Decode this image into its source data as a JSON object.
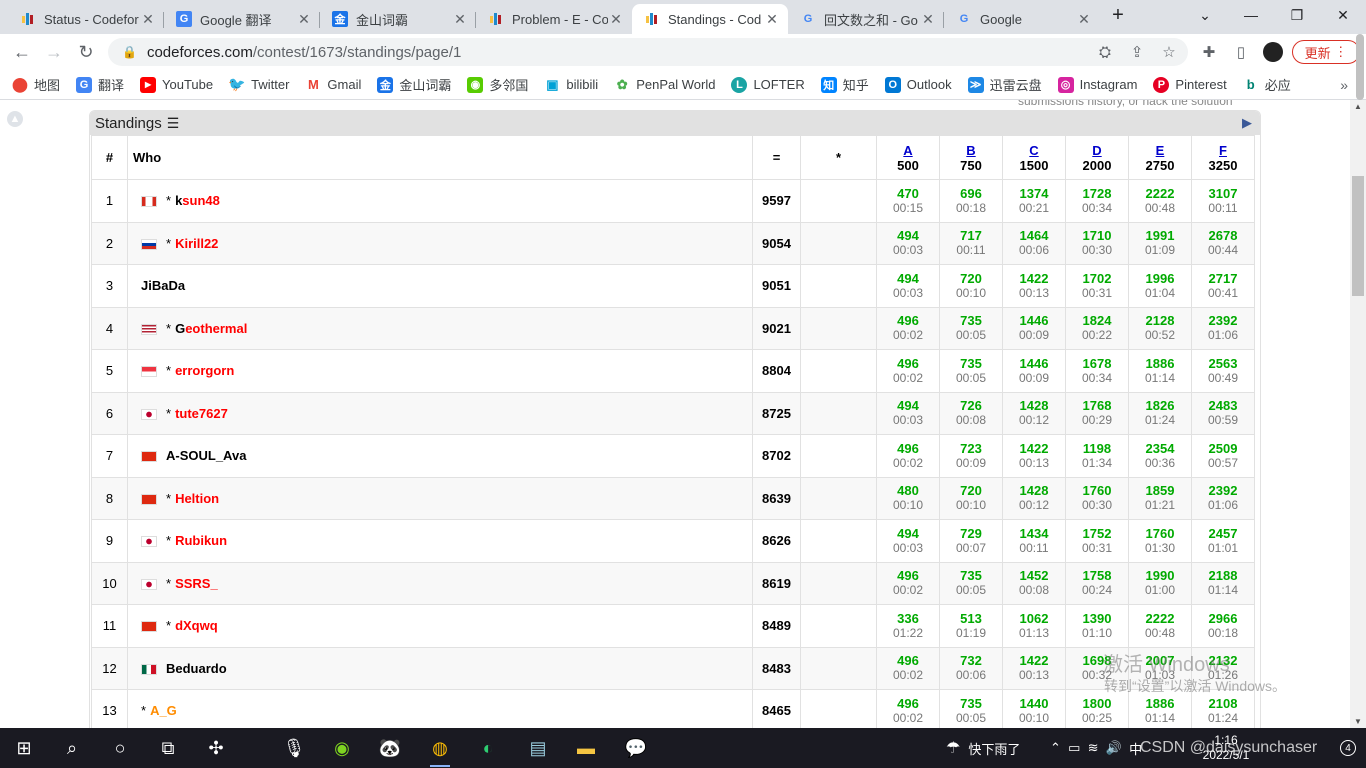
{
  "tabs": [
    {
      "title": "Status - Codefor",
      "icon": "codeforces-icon",
      "active": false
    },
    {
      "title": "Google 翻译",
      "icon": "google-translate-icon",
      "active": false
    },
    {
      "title": "金山词霸",
      "icon": "iciba-icon",
      "active": false
    },
    {
      "title": "Problem - E - Co",
      "icon": "codeforces-icon",
      "active": false
    },
    {
      "title": "Standings - Cod",
      "icon": "codeforces-icon",
      "active": true
    },
    {
      "title": "回文数之和 - Go",
      "icon": "google-icon",
      "active": false
    },
    {
      "title": "Google",
      "icon": "google-icon",
      "active": false
    }
  ],
  "address": {
    "host": "codeforces.com",
    "path": "/contest/1673/standings/page/1"
  },
  "update_label": "更新",
  "bookmarks": [
    "地图",
    "翻译",
    "YouTube",
    "Twitter",
    "Gmail",
    "金山词霸",
    "多邻国",
    "bilibili",
    "PenPal World",
    "LOFTER",
    "知乎",
    "Outlook",
    "迅雷云盘",
    "Instagram",
    "Pinterest",
    "必应"
  ],
  "hint": "submissions history, or hack the solution",
  "standings": {
    "title": "Standings",
    "headers": {
      "rank": "#",
      "who": "Who",
      "penalty": "=",
      "hacks": "*"
    },
    "problems": [
      {
        "letter": "A",
        "points": "500"
      },
      {
        "letter": "B",
        "points": "750"
      },
      {
        "letter": "C",
        "points": "1500"
      },
      {
        "letter": "D",
        "points": "2000"
      },
      {
        "letter": "E",
        "points": "2750"
      },
      {
        "letter": "F",
        "points": "3250"
      }
    ],
    "rows": [
      {
        "rank": "1",
        "flag": "ca",
        "star": "*",
        "first": "k",
        "rest": "sun48",
        "color": "#ff0000",
        "score": "9597",
        "cells": [
          [
            "470",
            "00:15"
          ],
          [
            "696",
            "00:18"
          ],
          [
            "1374",
            "00:21"
          ],
          [
            "1728",
            "00:34"
          ],
          [
            "2222",
            "00:48"
          ],
          [
            "3107",
            "00:11"
          ]
        ]
      },
      {
        "rank": "2",
        "flag": "ru",
        "star": "*",
        "first": "",
        "rest": "Kirill22",
        "color": "#ff0000",
        "score": "9054",
        "cells": [
          [
            "494",
            "00:03"
          ],
          [
            "717",
            "00:11"
          ],
          [
            "1464",
            "00:06"
          ],
          [
            "1710",
            "00:30"
          ],
          [
            "1991",
            "01:09"
          ],
          [
            "2678",
            "00:44"
          ]
        ]
      },
      {
        "rank": "3",
        "flag": "",
        "star": "",
        "first": "",
        "rest": "JiBaDa",
        "color": "#000000",
        "score": "9051",
        "cells": [
          [
            "494",
            "00:03"
          ],
          [
            "720",
            "00:10"
          ],
          [
            "1422",
            "00:13"
          ],
          [
            "1702",
            "00:31"
          ],
          [
            "1996",
            "01:04"
          ],
          [
            "2717",
            "00:41"
          ]
        ]
      },
      {
        "rank": "4",
        "flag": "us",
        "star": "*",
        "first": "G",
        "rest": "eothermal",
        "color": "#ff0000",
        "score": "9021",
        "cells": [
          [
            "496",
            "00:02"
          ],
          [
            "735",
            "00:05"
          ],
          [
            "1446",
            "00:09"
          ],
          [
            "1824",
            "00:22"
          ],
          [
            "2128",
            "00:52"
          ],
          [
            "2392",
            "01:06"
          ]
        ]
      },
      {
        "rank": "5",
        "flag": "sg",
        "star": "*",
        "first": "",
        "rest": "errorgorn",
        "color": "#ff0000",
        "score": "8804",
        "cells": [
          [
            "496",
            "00:02"
          ],
          [
            "735",
            "00:05"
          ],
          [
            "1446",
            "00:09"
          ],
          [
            "1678",
            "00:34"
          ],
          [
            "1886",
            "01:14"
          ],
          [
            "2563",
            "00:49"
          ]
        ]
      },
      {
        "rank": "6",
        "flag": "jp",
        "star": "*",
        "first": "",
        "rest": "tute7627",
        "color": "#ff0000",
        "score": "8725",
        "cells": [
          [
            "494",
            "00:03"
          ],
          [
            "726",
            "00:08"
          ],
          [
            "1428",
            "00:12"
          ],
          [
            "1768",
            "00:29"
          ],
          [
            "1826",
            "01:24"
          ],
          [
            "2483",
            "00:59"
          ]
        ]
      },
      {
        "rank": "7",
        "flag": "cn",
        "star": "",
        "first": "",
        "rest": "A-SOUL_Ava",
        "color": "#000000",
        "score": "8702",
        "cells": [
          [
            "496",
            "00:02"
          ],
          [
            "723",
            "00:09"
          ],
          [
            "1422",
            "00:13"
          ],
          [
            "1198",
            "01:34"
          ],
          [
            "2354",
            "00:36"
          ],
          [
            "2509",
            "00:57"
          ]
        ]
      },
      {
        "rank": "8",
        "flag": "cn",
        "star": "*",
        "first": "",
        "rest": "Heltion",
        "color": "#ff0000",
        "score": "8639",
        "cells": [
          [
            "480",
            "00:10"
          ],
          [
            "720",
            "00:10"
          ],
          [
            "1428",
            "00:12"
          ],
          [
            "1760",
            "00:30"
          ],
          [
            "1859",
            "01:21"
          ],
          [
            "2392",
            "01:06"
          ]
        ]
      },
      {
        "rank": "9",
        "flag": "jp",
        "star": "*",
        "first": "",
        "rest": "Rubikun",
        "color": "#ff0000",
        "score": "8626",
        "cells": [
          [
            "494",
            "00:03"
          ],
          [
            "729",
            "00:07"
          ],
          [
            "1434",
            "00:11"
          ],
          [
            "1752",
            "00:31"
          ],
          [
            "1760",
            "01:30"
          ],
          [
            "2457",
            "01:01"
          ]
        ]
      },
      {
        "rank": "10",
        "flag": "jp",
        "star": "*",
        "first": "",
        "rest": "SSRS_",
        "color": "#ff0000",
        "score": "8619",
        "cells": [
          [
            "496",
            "00:02"
          ],
          [
            "735",
            "00:05"
          ],
          [
            "1452",
            "00:08"
          ],
          [
            "1758",
            "00:24"
          ],
          [
            "1990",
            "01:00"
          ],
          [
            "2188",
            "01:14"
          ]
        ]
      },
      {
        "rank": "11",
        "flag": "cn",
        "star": "*",
        "first": "",
        "rest": "dXqwq",
        "color": "#ff0000",
        "score": "8489",
        "cells": [
          [
            "336",
            "01:22"
          ],
          [
            "513",
            "01:19"
          ],
          [
            "1062",
            "01:13"
          ],
          [
            "1390",
            "01:10"
          ],
          [
            "2222",
            "00:48"
          ],
          [
            "2966",
            "00:18"
          ]
        ]
      },
      {
        "rank": "12",
        "flag": "mx",
        "star": "",
        "first": "",
        "rest": "Beduardo",
        "color": "#000000",
        "score": "8483",
        "cells": [
          [
            "496",
            "00:02"
          ],
          [
            "732",
            "00:06"
          ],
          [
            "1422",
            "00:13"
          ],
          [
            "1698",
            "00:32"
          ],
          [
            "2007",
            "01:03"
          ],
          [
            "2132",
            "01:26"
          ]
        ]
      },
      {
        "rank": "13",
        "flag": "",
        "star": "*",
        "first": "",
        "rest": "A_G",
        "color": "#ff8c00",
        "score": "8465",
        "cells": [
          [
            "496",
            "00:02"
          ],
          [
            "735",
            "00:05"
          ],
          [
            "1440",
            "00:10"
          ],
          [
            "1800",
            "00:25"
          ],
          [
            "1886",
            "01:14"
          ],
          [
            "2108",
            "01:24"
          ]
        ]
      }
    ]
  },
  "watermark": {
    "line1": "激活 Windows",
    "line2": "转到“设置”以激活 Windows。"
  },
  "taskbar": {
    "weather": "快下雨了",
    "ime": "中",
    "time": "1:16",
    "date": "2022/5/1",
    "notif": "4",
    "csdn": "CSDN @daisysunchaser"
  }
}
